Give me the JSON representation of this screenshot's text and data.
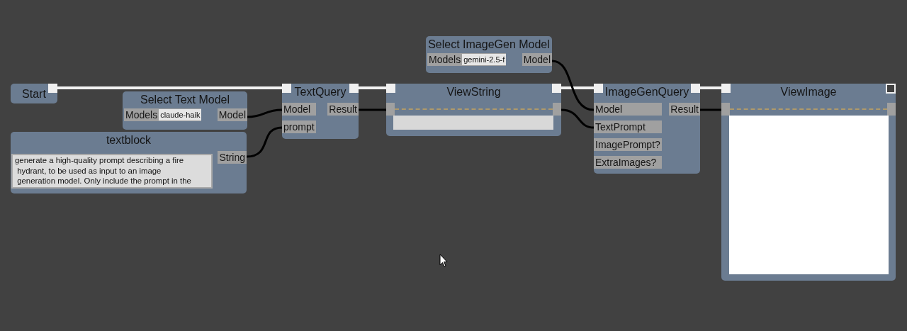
{
  "nodes": [
    {
      "kind": "start",
      "title": "Start"
    },
    {
      "kind": "select",
      "title": "Select Text Model",
      "field_label": "Models",
      "value": "claude-haik",
      "outputs": [
        "Model"
      ]
    },
    {
      "kind": "text",
      "title": "textblock",
      "text": "generate a high-quality prompt describing a fire\n hydrant, to be used as input to an image\n generation model. Only include the prompt in the",
      "outputs": [
        "String"
      ]
    },
    {
      "kind": "query",
      "title": "TextQuery",
      "inputs": [
        "Model",
        "prompt"
      ],
      "outputs": [
        "Result"
      ]
    },
    {
      "kind": "view_string",
      "title": "ViewString"
    },
    {
      "kind": "select",
      "title": "Select ImageGen Model",
      "field_label": "Models",
      "value": "gemini-2.5-f",
      "outputs": [
        "Model"
      ]
    },
    {
      "kind": "query",
      "title": "ImageGenQuery",
      "inputs": [
        "Model",
        "TextPrompt",
        "ImagePrompt?",
        "ExtraImages?"
      ],
      "outputs": [
        "Result"
      ]
    },
    {
      "kind": "view_image",
      "title": "ViewImage"
    }
  ]
}
